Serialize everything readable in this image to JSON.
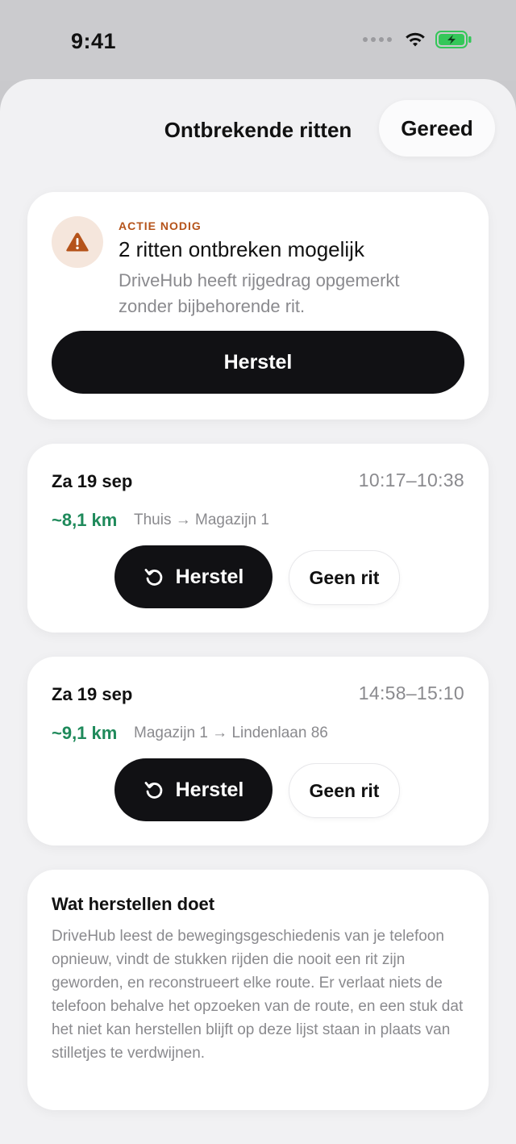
{
  "status_bar": {
    "time": "9:41"
  },
  "sheet": {
    "title": "Ontbrekende ritten",
    "done_label": "Gereed"
  },
  "alert": {
    "eyebrow": "ACTIE NODIG",
    "title": "2 ritten ontbreken mogelijk",
    "description": "DriveHub heeft rijgedrag opgemerkt zonder bijbehorende rit.",
    "button_label": "Herstel",
    "icon": "warning-icon"
  },
  "trips": [
    {
      "date": "Za 19 sep",
      "time": "10:17–10:38",
      "distance": "~8,1 km",
      "route": "Thuis → Magazijn 1",
      "restore_label": "Herstel",
      "dismiss_label": "Geen rit"
    },
    {
      "date": "Za 19 sep",
      "time": "14:58–15:10",
      "distance": "~9,1 km",
      "route": "Magazijn 1 → Lindenlaan 86",
      "restore_label": "Herstel",
      "dismiss_label": "Geen rit"
    }
  ],
  "info": {
    "title": "Wat herstellen doet",
    "body": "DriveHub leest de bewegingsgeschiedenis van je telefoon opnieuw, vindt de stukken rijden die nooit een rit zijn geworden, en reconstrueert elke route. Er verlaat niets de telefoon behalve het opzoeken van de route, en een stuk dat het niet kan herstellen blijft op deze lijst staan in plaats van stilletjes te verdwijnen."
  },
  "colors": {
    "accent_green": "#1f8a5b",
    "warning_orange": "#b5531a",
    "battery_green": "#34c759"
  }
}
